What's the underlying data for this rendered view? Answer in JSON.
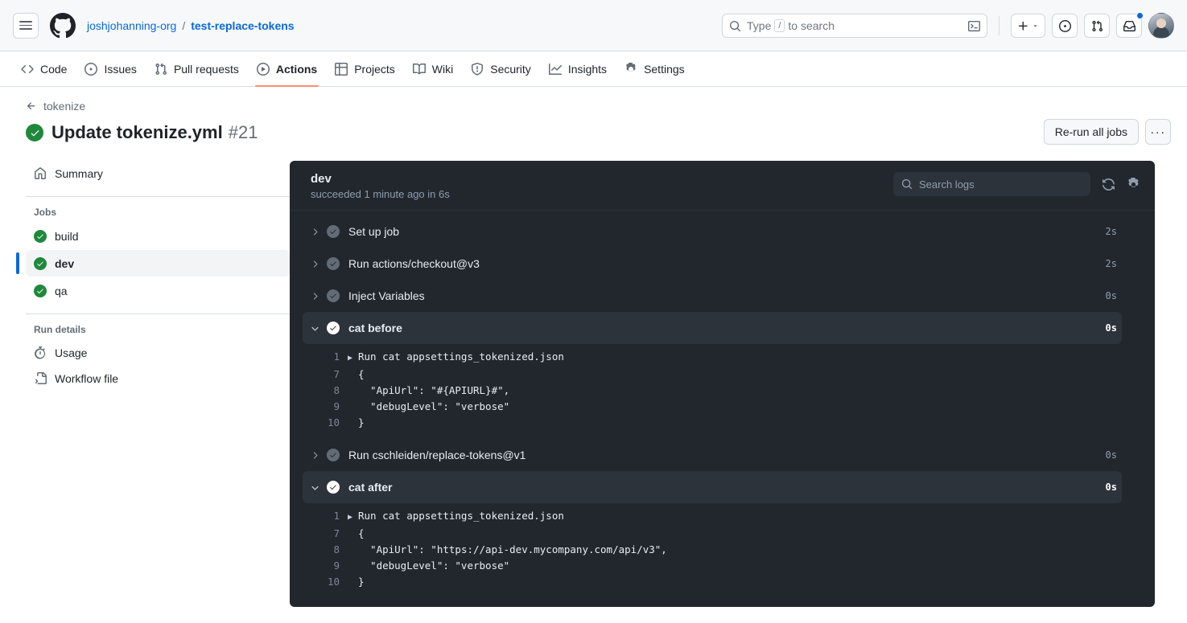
{
  "header": {
    "org": "joshjohanning-org",
    "separator": "/",
    "repo": "test-replace-tokens",
    "search_placeholder": "Type",
    "search_key": "/",
    "search_placeholder_tail": "to search"
  },
  "nav": {
    "items": [
      {
        "label": "Code",
        "icon": "code-icon",
        "active": false
      },
      {
        "label": "Issues",
        "icon": "issue-opened-icon",
        "active": false
      },
      {
        "label": "Pull requests",
        "icon": "git-pull-request-icon",
        "active": false
      },
      {
        "label": "Actions",
        "icon": "play-icon",
        "active": true
      },
      {
        "label": "Projects",
        "icon": "table-icon",
        "active": false
      },
      {
        "label": "Wiki",
        "icon": "book-icon",
        "active": false
      },
      {
        "label": "Security",
        "icon": "shield-icon",
        "active": false
      },
      {
        "label": "Insights",
        "icon": "graph-icon",
        "active": false
      },
      {
        "label": "Settings",
        "icon": "gear-icon",
        "active": false
      }
    ]
  },
  "run": {
    "back_label": "tokenize",
    "title": "Update tokenize.yml",
    "number": "#21",
    "rerun_label": "Re-run all jobs",
    "kebab_label": "···"
  },
  "sidebar": {
    "summary_label": "Summary",
    "jobs_heading": "Jobs",
    "jobs": [
      {
        "label": "build",
        "selected": false
      },
      {
        "label": "dev",
        "selected": true
      },
      {
        "label": "qa",
        "selected": false
      }
    ],
    "run_details_heading": "Run details",
    "usage_label": "Usage",
    "workflow_file_label": "Workflow file"
  },
  "log_panel": {
    "job_name": "dev",
    "job_status": "succeeded 1 minute ago in 6s",
    "search_placeholder": "Search logs",
    "steps": [
      {
        "label": "Set up job",
        "duration": "2s",
        "expanded": false
      },
      {
        "label": "Run actions/checkout@v3",
        "duration": "2s",
        "expanded": false
      },
      {
        "label": "Inject Variables",
        "duration": "0s",
        "expanded": false
      },
      {
        "label": "cat before",
        "duration": "0s",
        "expanded": true,
        "lines": [
          {
            "n": "1",
            "marker": "▶",
            "text": "Run cat appsettings_tokenized.json"
          },
          {
            "n": "7",
            "marker": "",
            "text": "{"
          },
          {
            "n": "8",
            "marker": "",
            "text": "  \"ApiUrl\": \"#{APIURL}#\","
          },
          {
            "n": "9",
            "marker": "",
            "text": "  \"debugLevel\": \"verbose\""
          },
          {
            "n": "10",
            "marker": "",
            "text": "}"
          }
        ]
      },
      {
        "label": "Run cschleiden/replace-tokens@v1",
        "duration": "0s",
        "expanded": false
      },
      {
        "label": "cat after",
        "duration": "0s",
        "expanded": true,
        "lines": [
          {
            "n": "1",
            "marker": "▶",
            "text": "Run cat appsettings_tokenized.json"
          },
          {
            "n": "7",
            "marker": "",
            "text": "{"
          },
          {
            "n": "8",
            "marker": "",
            "text": "  \"ApiUrl\": \"",
            "link": "https://api-dev.mycompany.com/api/v3",
            "text_after": "\","
          },
          {
            "n": "9",
            "marker": "",
            "text": "  \"debugLevel\": \"verbose\""
          },
          {
            "n": "10",
            "marker": "",
            "text": "}"
          }
        ]
      }
    ]
  },
  "colors": {
    "accent_orange": "#fd8c73",
    "success_green": "#1f883d",
    "link_blue": "#0969da",
    "panel_dark": "#22272e",
    "panel_row_highlight": "#2d333b"
  }
}
